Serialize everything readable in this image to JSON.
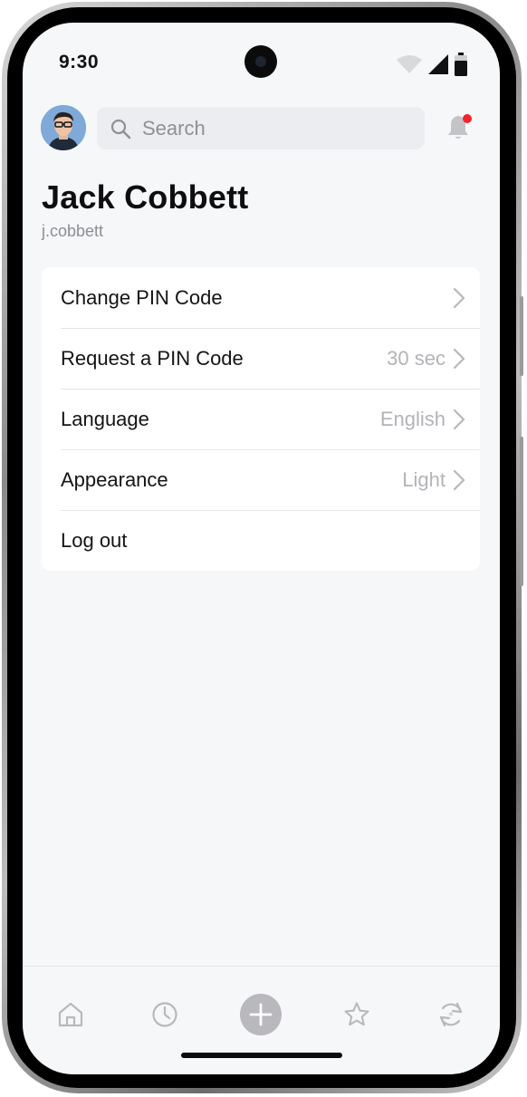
{
  "status_bar": {
    "time": "9:30",
    "icons": [
      "wifi-icon",
      "signal-icon",
      "battery-icon"
    ]
  },
  "header": {
    "avatar": "avatar",
    "search_placeholder": "Search",
    "search_icon": "search-icon",
    "notification_icon": "bell-icon",
    "notification_badge_color": "#f2242c"
  },
  "profile": {
    "name": "Jack Cobbett",
    "username": "j.cobbett"
  },
  "menu": {
    "items": [
      {
        "label": "Change PIN Code",
        "value": "",
        "chevron": true
      },
      {
        "label": "Request a PIN Code",
        "value": "30 sec",
        "chevron": true
      },
      {
        "label": "Language",
        "value": "English",
        "chevron": true
      },
      {
        "label": "Appearance",
        "value": "Light",
        "chevron": true
      },
      {
        "label": "Log out",
        "value": "",
        "chevron": false
      }
    ]
  },
  "bottom_nav": {
    "items": [
      "home-icon",
      "history-clock-icon",
      "add-icon",
      "favorites-star-icon",
      "sync-icon"
    ]
  },
  "colors": {
    "background": "#f6f7f9",
    "card": "#ffffff",
    "secondary_text": "#b3b3b8",
    "nav_icon": "#b9b9bd"
  }
}
